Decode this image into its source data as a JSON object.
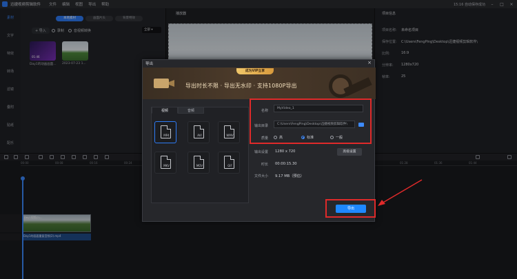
{
  "app": {
    "title": "迅捷视频剪辑软件",
    "menu": [
      "文件",
      "编辑",
      "视图",
      "导出",
      "帮助"
    ],
    "status": "15:16 自动保存成功"
  },
  "sidenav": {
    "items": [
      "素材",
      "文字",
      "特效",
      "转场",
      "滤镜",
      "叠附",
      "贴纸",
      "配乐"
    ]
  },
  "media": {
    "tabs": [
      "本地素材",
      "画面片头",
      "背景特效"
    ],
    "import_label": "导入",
    "record_label": "录制",
    "convert_label": "音视频转换",
    "filter_value": "全部",
    "thumbs": [
      {
        "caption": "Day1的动画画面...",
        "duration": "01:46"
      },
      {
        "caption": "2023-07-23 1...",
        "duration": ""
      }
    ]
  },
  "player": {
    "title": "播放器"
  },
  "project": {
    "title": "项目信息",
    "rows": [
      {
        "label": "项目名称:",
        "value": "未命名项目"
      },
      {
        "label": "保存位置:",
        "value": "C:\\Users\\FengPing\\Desktop\\迅捷视频剪辑软件\\"
      },
      {
        "label": "比例:",
        "value": "16:9"
      },
      {
        "label": "分辨率:",
        "value": "1280x720"
      },
      {
        "label": "帧率:",
        "value": "25"
      }
    ]
  },
  "timeline": {
    "ticks": [
      "00:00",
      "00:08",
      "00:16",
      "00:24",
      "00:32",
      "00:40",
      "00:48",
      "00:56",
      "01:04",
      "01:12",
      "01:20",
      "01:28",
      "01:36",
      "01:44"
    ],
    "video_clip_label": "Day1视频(2)...",
    "audio_clip_label": "Day1的画面重复音频(2).mp4"
  },
  "dialog": {
    "title": "导出",
    "close": "×",
    "banner_pill": "成为VIP立享",
    "banner_text": "导出时长不限 · 导出无水印 · 支持1080P导出",
    "tab_video": "视频",
    "tab_audio": "音频",
    "formats": [
      "MP4",
      "AVI",
      "WMV",
      "MKV",
      "MOV",
      "GIF"
    ],
    "name_label": "名称",
    "name_value": "MyVideo_1",
    "dir_label": "输出目录",
    "dir_value": "C:\\Users\\FengPing\\Desktop\\迅捷视频剪辑软件\\",
    "quality_label": "质量",
    "quality_options": [
      "高",
      "标准",
      "一般"
    ],
    "output_label": "输出设置",
    "output_value": "1280 x 720",
    "duration_label": "时长",
    "duration_value": "00:00:15.30",
    "size_label": "文件大小",
    "size_value": "9.17 MB（预估）",
    "advanced_label": "高级设置",
    "export_label": "导出"
  }
}
